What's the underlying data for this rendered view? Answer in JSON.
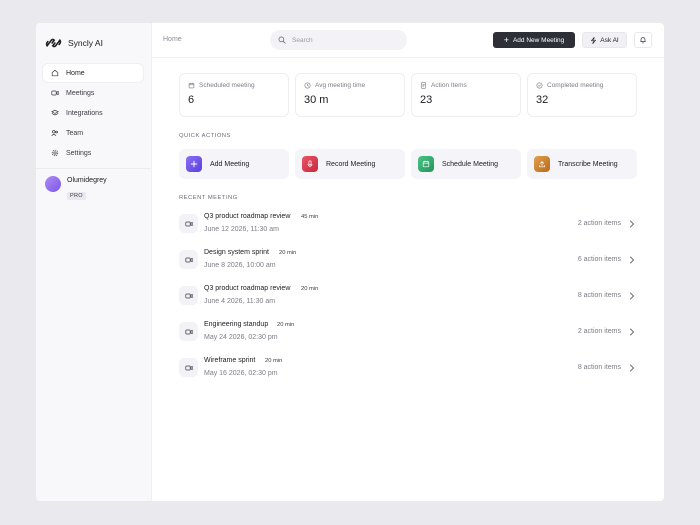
{
  "app": {
    "name": "Syncly AI"
  },
  "sidebar": {
    "items": [
      {
        "label": "Home",
        "icon": "home-icon",
        "active": true
      },
      {
        "label": "Meetings",
        "icon": "video-icon",
        "active": false
      },
      {
        "label": "Integrations",
        "icon": "layers-icon",
        "active": false
      },
      {
        "label": "Team",
        "icon": "team-icon",
        "active": false
      },
      {
        "label": "Settings",
        "icon": "gear-icon",
        "active": false
      }
    ],
    "user": {
      "name": "Olumidegrey",
      "plan": "PRO"
    }
  },
  "header": {
    "breadcrumb": "Home",
    "search_placeholder": "Search",
    "add_meeting_label": "Add New Meeting",
    "ask_ai_label": "Ask AI"
  },
  "stats": [
    {
      "label": "Scheduled meeting",
      "value": "6",
      "icon": "calendar-icon"
    },
    {
      "label": "Avg meeting time",
      "value": "30 m",
      "icon": "clock-icon"
    },
    {
      "label": "Action Items",
      "value": "23",
      "icon": "document-icon"
    },
    {
      "label": "Completed meeting",
      "value": "32",
      "icon": "check-circle-icon"
    }
  ],
  "quick_actions": {
    "title": "QUICK ACTIONS",
    "items": [
      {
        "label": "Add Meeting",
        "icon": "plus-icon",
        "color": "#6b4ee6"
      },
      {
        "label": "Record Meeting",
        "icon": "mic-icon",
        "color": "#d8364a"
      },
      {
        "label": "Schedule Meeting",
        "icon": "calendar-icon",
        "color": "#2ea86b"
      },
      {
        "label": "Transcribe Meeting",
        "icon": "upload-icon",
        "color": "#c57a24"
      }
    ]
  },
  "recent": {
    "title": "RECENT MEETING",
    "meetings": [
      {
        "title": "Q3 product roadmap review",
        "duration": "45 min",
        "date": "June 12 2026, 11:30 am",
        "actions": "2 action items"
      },
      {
        "title": "Design system sprint",
        "duration": "20 min",
        "date": "June 8 2026, 10:00 am",
        "actions": "6 action items"
      },
      {
        "title": "Q3 product roadmap review",
        "duration": "20 min",
        "date": "June 4 2026, 11:30 am",
        "actions": "8 action items"
      },
      {
        "title": "Engineering standup",
        "duration": "20 min",
        "date": "May 24 2026, 02:30 pm",
        "actions": "2 action items"
      },
      {
        "title": "Wireframe sprint",
        "duration": "20 min",
        "date": "May 16 2026, 02:30 pm",
        "actions": "8 action items"
      }
    ]
  }
}
